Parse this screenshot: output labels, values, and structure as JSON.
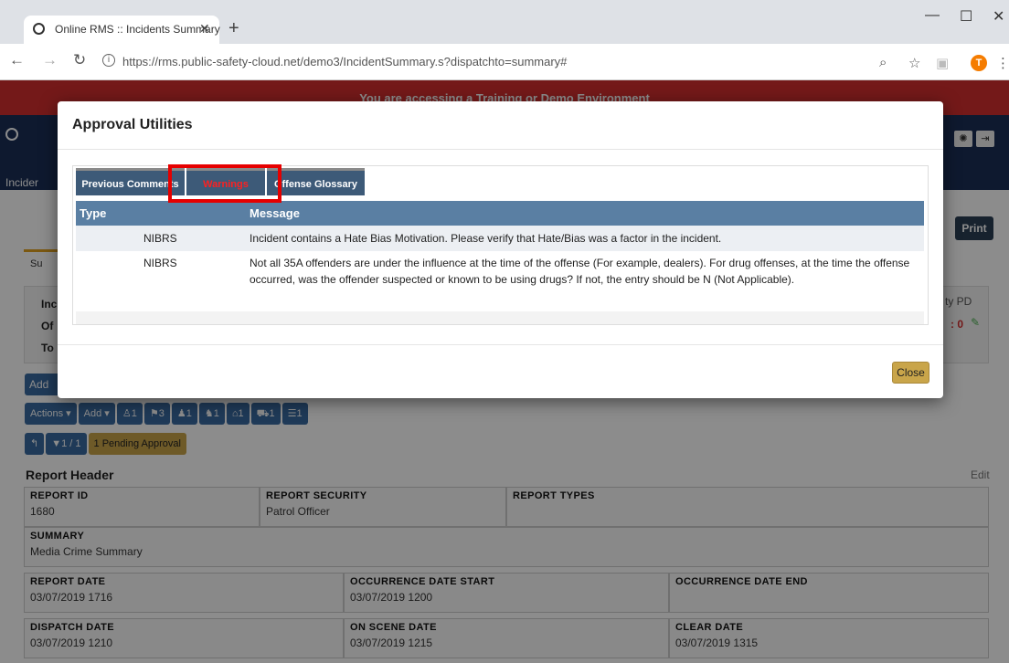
{
  "browser": {
    "tab_title": "Online RMS :: Incidents Summary",
    "url": "https://rms.public-safety-cloud.net/demo3/IncidentSummary.s?dispatchto=summary#",
    "profile_initial": "T"
  },
  "app": {
    "banner": "You are accessing a Training or Demo Environment",
    "nav_incident": "Incider",
    "print_label": "Print",
    "summary_tab": "Su",
    "summary_labels": [
      "Inc",
      "Of",
      "To"
    ],
    "pd_text": "ty PD",
    "counter": ": 0",
    "add_label": "Add",
    "actions_label": "Actions",
    "add_menu_label": "Add",
    "counts": [
      "1",
      "3",
      "1",
      "1",
      "1",
      "1",
      "1"
    ],
    "filter_count": "1 / 1",
    "pending": "1 Pending Approval",
    "report_header": {
      "title": "Report Header",
      "edit": "Edit",
      "report_id_label": "Report ID",
      "report_id": "1680",
      "security_label": "Report Security",
      "security": "Patrol Officer",
      "types_label": "Report Types",
      "summary_label": "Summary",
      "summary": "Media Crime Summary",
      "report_date_label": "Report Date",
      "report_date": "03/07/2019 1716",
      "occ_start_label": "Occurrence Date Start",
      "occ_start": "03/07/2019 1200",
      "occ_end_label": "Occurrence Date End",
      "dispatch_label": "Dispatch Date",
      "dispatch": "03/07/2019 1210",
      "onscene_label": "On Scene Date",
      "onscene": "03/07/2019 1215",
      "clear_label": "Clear Date",
      "clear": "03/07/2019 1315"
    }
  },
  "modal": {
    "title": "Approval Utilities",
    "tabs": [
      "Previous Comments",
      "Warnings",
      "Offense Glossary"
    ],
    "active_tab": "Warnings",
    "col_type": "Type",
    "col_message": "Message",
    "rows": [
      {
        "type": "NIBRS",
        "message": "Incident contains a Hate Bias Motivation. Please verify that Hate/Bias was a factor in the incident."
      },
      {
        "type": "NIBRS",
        "message": "Not all 35A offenders are under the influence at the time of the offense (For example, dealers). For drug offenses, at the time the offense occurred, was the offender suspected or known to be using drugs?  If not, the entry should be N (Not Applicable)."
      }
    ],
    "close_label": "Close"
  },
  "colors": {
    "accent": "#3d5a78",
    "warning_tab": "#ff2020",
    "highlight": "#e60000",
    "banner": "#d32f2f"
  }
}
